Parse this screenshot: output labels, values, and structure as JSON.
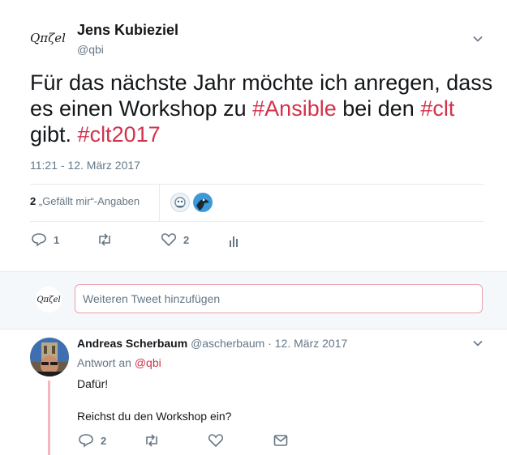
{
  "tweet": {
    "author_name": "Jens Kubieziel",
    "author_handle": "@qbi",
    "avatar_text": "Qπζel",
    "text_parts": [
      {
        "text": "Für das nächste Jahr möchte ich anregen, dass es einen Workshop zu ",
        "type": "text"
      },
      {
        "text": "#Ansible",
        "type": "hashtag"
      },
      {
        "text": " bei den ",
        "type": "text"
      },
      {
        "text": "#clt",
        "type": "hashtag"
      },
      {
        "text": " gibt. ",
        "type": "text"
      },
      {
        "text": "#clt2017",
        "type": "hashtag"
      }
    ],
    "timestamp": "11:21 - 12. März 2017",
    "likes_count": "2",
    "likes_label": "„Gefällt mir“-Angaben",
    "actions": {
      "reply_count": "1",
      "retweet_count": "",
      "like_count": "2"
    }
  },
  "compose": {
    "avatar_text": "Qπζel",
    "placeholder": "Weiteren Tweet hinzufügen"
  },
  "reply": {
    "author_name": "Andreas Scherbaum",
    "author_handle": "@ascherbaum",
    "separator": "·",
    "date": "12. März 2017",
    "reply_prefix": "Antwort an",
    "reply_to_handle": "@qbi",
    "line1": "Dafür!",
    "line2": "Reichst du den Workshop ein?",
    "actions": {
      "reply_count": "2"
    }
  },
  "colors": {
    "accent": "#d1334a",
    "muted": "#657786",
    "text": "#14171a",
    "divider": "#e6ecf0",
    "thread_line": "#f3b6c0"
  }
}
